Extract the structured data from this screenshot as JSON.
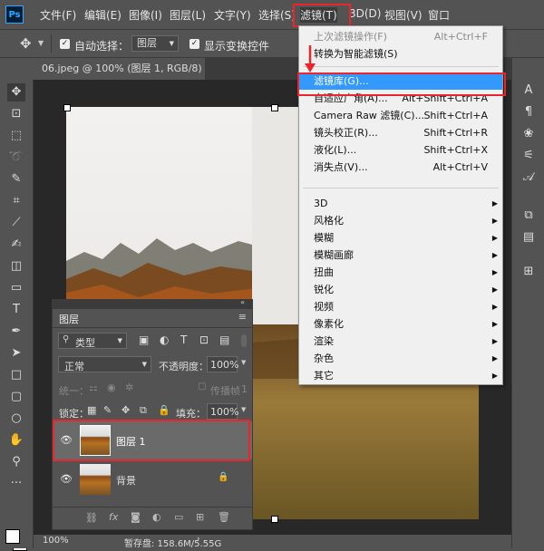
{
  "app": {
    "logo": "Ps"
  },
  "menubar": {
    "items": [
      "文件(F)",
      "编辑(E)",
      "图像(I)",
      "图层(L)",
      "文字(Y)",
      "选择(S)",
      "滤镜(T)",
      "3D(D)",
      "视图(V)",
      "窗口"
    ],
    "active": "滤镜(T)"
  },
  "options": {
    "auto_select_label": "自动选择：",
    "auto_select_value": "图层",
    "show_transform_label": "显示变换控件"
  },
  "document": {
    "tab_title": "06.jpeg @ 100% (图层 1, RGB/8) *",
    "tab_close": "×"
  },
  "filter_menu": {
    "items": [
      {
        "label": "上次滤镜操作(F)",
        "shortcut": "Alt+Ctrl+F",
        "disabled": true
      },
      {
        "label": "转换为智能滤镜(S)",
        "shortcut": ""
      },
      {
        "label": "滤镜库(G)...",
        "shortcut": "",
        "highlighted": true
      },
      {
        "label": "自适应广角(A)...",
        "shortcut": "Alt+Shift+Ctrl+A"
      },
      {
        "label": "Camera Raw 滤镜(C)...",
        "shortcut": "Shift+Ctrl+A"
      },
      {
        "label": "镜头校正(R)...",
        "shortcut": "Shift+Ctrl+R"
      },
      {
        "label": "液化(L)...",
        "shortcut": "Shift+Ctrl+X"
      },
      {
        "label": "消失点(V)...",
        "shortcut": "Alt+Ctrl+V"
      },
      {
        "label": "3D",
        "submenu": true
      },
      {
        "label": "风格化",
        "submenu": true
      },
      {
        "label": "模糊",
        "submenu": true
      },
      {
        "label": "模糊画廊",
        "submenu": true
      },
      {
        "label": "扭曲",
        "submenu": true
      },
      {
        "label": "锐化",
        "submenu": true
      },
      {
        "label": "视频",
        "submenu": true
      },
      {
        "label": "像素化",
        "submenu": true
      },
      {
        "label": "渲染",
        "submenu": true
      },
      {
        "label": "杂色",
        "submenu": true
      },
      {
        "label": "其它",
        "submenu": true
      }
    ]
  },
  "layers_panel": {
    "title": "图层",
    "filter_label": "类型",
    "blend_mode": "正常",
    "opacity_label": "不透明度：",
    "opacity_value": "100%",
    "unify_label": "统一：",
    "propagate_label": "传播帧",
    "propagate_value": "1",
    "lock_label": "锁定：",
    "fill_label": "填充：",
    "fill_value": "100%",
    "layers": [
      {
        "name": "图层 1",
        "selected": true
      },
      {
        "name": "背景",
        "locked": true
      }
    ]
  },
  "status": {
    "zoom": "100%",
    "scratch": "暂存盘: 158.6M/5.55G"
  },
  "colors": {
    "highlight": "#3399ff",
    "annotation": "#e8262b",
    "panel": "#535353"
  }
}
